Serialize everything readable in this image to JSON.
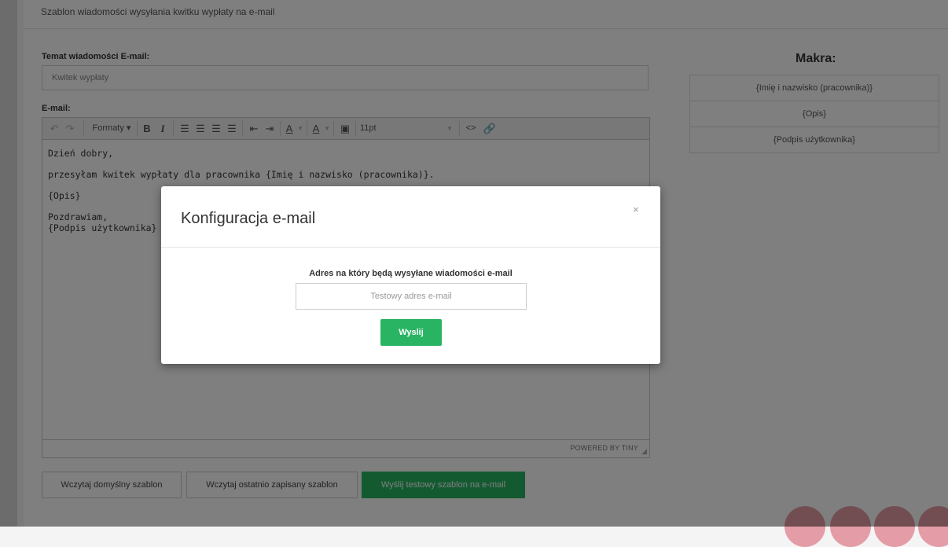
{
  "panel": {
    "title": "Szablon wiadomości wysyłania kwitku wypłaty na e-mail"
  },
  "subject": {
    "label": "Temat wiadomości E-mail:",
    "value": "Kwitek wypłaty"
  },
  "editor": {
    "label": "E-mail:",
    "toolbar": {
      "formats_label": "Formaty",
      "font_size": "11pt"
    },
    "content": {
      "greeting": "Dzień dobry,",
      "line1": "przesyłam kwitek wypłaty dla pracownika {Imię i nazwisko (pracownika)}.",
      "line2": "{Opis}",
      "closing": "Pozdrawiam,",
      "signature": "{Podpis użytkownika}"
    },
    "powered_by": "POWERED BY TINY"
  },
  "macros": {
    "title": "Makra:",
    "items": [
      "{Imię i nazwisko (pracownika)}",
      "{Opis}",
      "{Podpis użytkownika}"
    ]
  },
  "buttons": {
    "load_default": "Wczytaj domyślny szablon",
    "load_last": "Wczytaj ostatnio zapisany szablon",
    "send_test": "Wyślij testowy szablon na e-mail"
  },
  "modal": {
    "title": "Konfiguracja e-mail",
    "close": "×",
    "field_label": "Adres na który będą wysyłane wiadomości e-mail",
    "input_placeholder": "Testowy adres e-mail",
    "send_label": "Wyslij"
  },
  "colors": {
    "accent_green": "#28b463",
    "fab_pink": "#e49ca6"
  }
}
